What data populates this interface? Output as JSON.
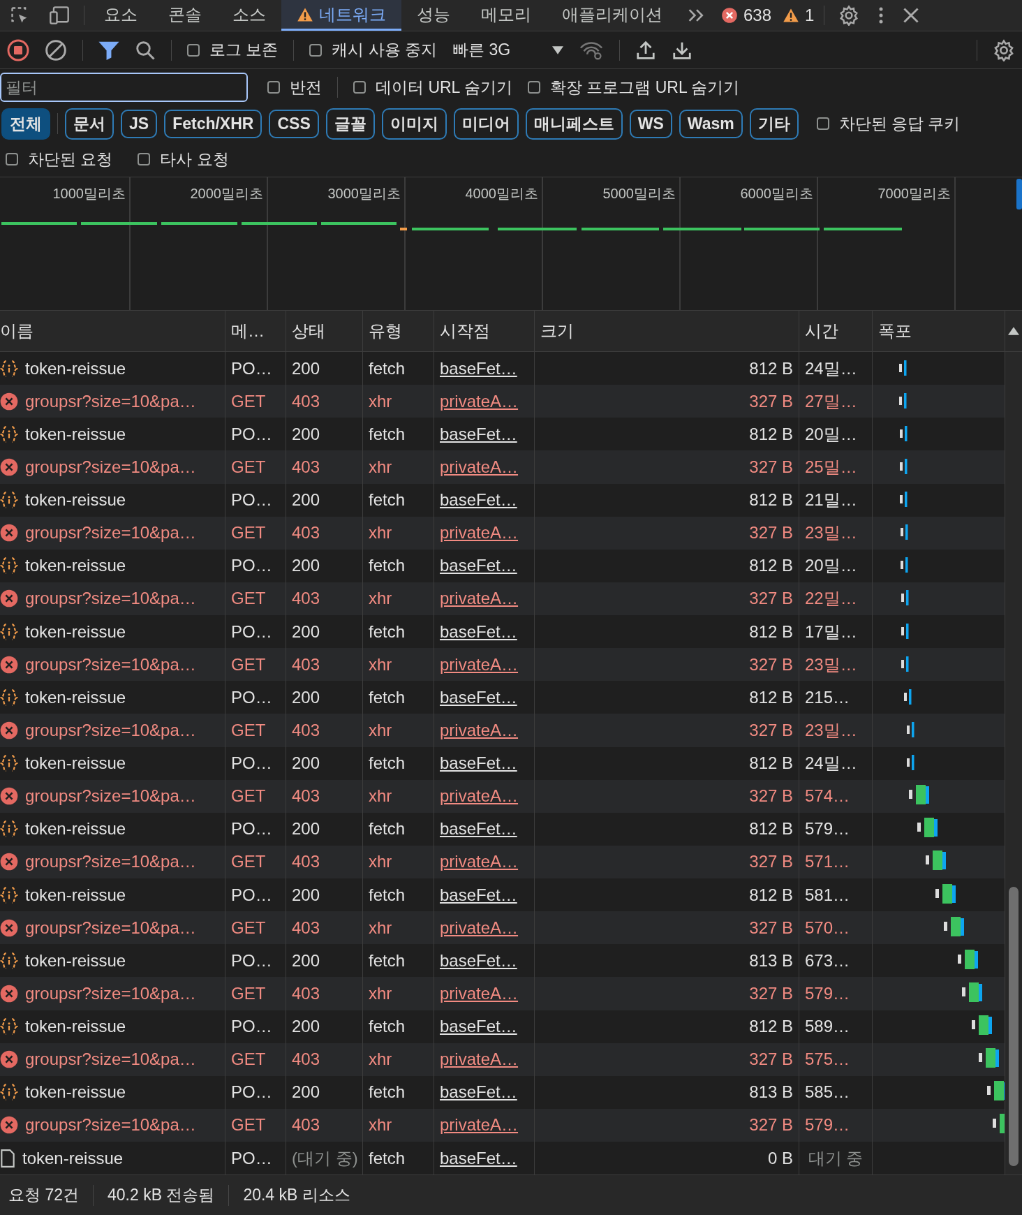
{
  "tabs": [
    {
      "label": "요소",
      "selected": false,
      "warning": false
    },
    {
      "label": "콘솔",
      "selected": false,
      "warning": false
    },
    {
      "label": "소스",
      "selected": false,
      "warning": false
    },
    {
      "label": "네트워크",
      "selected": true,
      "warning": true
    },
    {
      "label": "성능",
      "selected": false,
      "warning": false
    },
    {
      "label": "메모리",
      "selected": false,
      "warning": false
    },
    {
      "label": "애플리케이션",
      "selected": false,
      "warning": false
    }
  ],
  "counts": {
    "errors": "638",
    "warnings": "1"
  },
  "toolbar": {
    "recording": true,
    "filter_active": true,
    "options": [
      {
        "label": "로그 보존",
        "checked": false
      },
      {
        "label": "캐시 사용 중지",
        "checked": false
      }
    ],
    "throttling": "빠른 3G"
  },
  "filter": {
    "placeholder": "필터",
    "options": [
      {
        "label": "반전",
        "checked": false
      },
      {
        "label": "데이터 URL 숨기기",
        "checked": false
      },
      {
        "label": "확장 프로그램 URL 숨기기",
        "checked": false
      }
    ]
  },
  "type_filters": [
    {
      "label": "전체",
      "selected": true
    },
    {
      "label": "문서",
      "selected": false
    },
    {
      "label": "JS",
      "selected": false
    },
    {
      "label": "Fetch/XHR",
      "selected": false
    },
    {
      "label": "CSS",
      "selected": false
    },
    {
      "label": "글꼴",
      "selected": false
    },
    {
      "label": "이미지",
      "selected": false
    },
    {
      "label": "미디어",
      "selected": false
    },
    {
      "label": "매니페스트",
      "selected": false
    },
    {
      "label": "WS",
      "selected": false
    },
    {
      "label": "Wasm",
      "selected": false
    },
    {
      "label": "기타",
      "selected": false
    }
  ],
  "blocked_cookies": {
    "label": "차단된 응답 쿠키",
    "checked": false
  },
  "extra_options": [
    {
      "label": "차단된 요청",
      "checked": false
    },
    {
      "label": "타사 요청",
      "checked": false
    }
  ],
  "overview": {
    "ticks": [
      "1000밀리초",
      "2000밀리초",
      "3000밀리초",
      "4000밀리초",
      "5000밀리초",
      "6000밀리초",
      "7000밀리초"
    ]
  },
  "table": {
    "columns": [
      "이름",
      "메…",
      "상태",
      "유형",
      "시작점",
      "크기",
      "시간",
      "폭포"
    ],
    "rows": [
      {
        "kind": "fetch",
        "name": "token-reissue",
        "method": "PO…",
        "status": "200",
        "type": "fetch",
        "initiator": "baseFet…",
        "size": "812 B",
        "time": "24밀…"
      },
      {
        "kind": "error",
        "name": "groupsr?size=10&pa…",
        "method": "GET",
        "status": "403",
        "type": "xhr",
        "initiator": "privateA…",
        "size": "327 B",
        "time": "27밀…"
      },
      {
        "kind": "fetch",
        "name": "token-reissue",
        "method": "PO…",
        "status": "200",
        "type": "fetch",
        "initiator": "baseFet…",
        "size": "812 B",
        "time": "20밀…"
      },
      {
        "kind": "error",
        "name": "groupsr?size=10&pa…",
        "method": "GET",
        "status": "403",
        "type": "xhr",
        "initiator": "privateA…",
        "size": "327 B",
        "time": "25밀…"
      },
      {
        "kind": "fetch",
        "name": "token-reissue",
        "method": "PO…",
        "status": "200",
        "type": "fetch",
        "initiator": "baseFet…",
        "size": "812 B",
        "time": "21밀…"
      },
      {
        "kind": "error",
        "name": "groupsr?size=10&pa…",
        "method": "GET",
        "status": "403",
        "type": "xhr",
        "initiator": "privateA…",
        "size": "327 B",
        "time": "23밀…"
      },
      {
        "kind": "fetch",
        "name": "token-reissue",
        "method": "PO…",
        "status": "200",
        "type": "fetch",
        "initiator": "baseFet…",
        "size": "812 B",
        "time": "20밀…"
      },
      {
        "kind": "error",
        "name": "groupsr?size=10&pa…",
        "method": "GET",
        "status": "403",
        "type": "xhr",
        "initiator": "privateA…",
        "size": "327 B",
        "time": "22밀…"
      },
      {
        "kind": "fetch",
        "name": "token-reissue",
        "method": "PO…",
        "status": "200",
        "type": "fetch",
        "initiator": "baseFet…",
        "size": "812 B",
        "time": "17밀…"
      },
      {
        "kind": "error",
        "name": "groupsr?size=10&pa…",
        "method": "GET",
        "status": "403",
        "type": "xhr",
        "initiator": "privateA…",
        "size": "327 B",
        "time": "23밀…"
      },
      {
        "kind": "fetch",
        "name": "token-reissue",
        "method": "PO…",
        "status": "200",
        "type": "fetch",
        "initiator": "baseFet…",
        "size": "812 B",
        "time": "215…"
      },
      {
        "kind": "error",
        "name": "groupsr?size=10&pa…",
        "method": "GET",
        "status": "403",
        "type": "xhr",
        "initiator": "privateA…",
        "size": "327 B",
        "time": "23밀…"
      },
      {
        "kind": "fetch",
        "name": "token-reissue",
        "method": "PO…",
        "status": "200",
        "type": "fetch",
        "initiator": "baseFet…",
        "size": "812 B",
        "time": "24밀…"
      },
      {
        "kind": "error",
        "name": "groupsr?size=10&pa…",
        "method": "GET",
        "status": "403",
        "type": "xhr",
        "initiator": "privateA…",
        "size": "327 B",
        "time": "574…"
      },
      {
        "kind": "fetch",
        "name": "token-reissue",
        "method": "PO…",
        "status": "200",
        "type": "fetch",
        "initiator": "baseFet…",
        "size": "812 B",
        "time": "579…"
      },
      {
        "kind": "error",
        "name": "groupsr?size=10&pa…",
        "method": "GET",
        "status": "403",
        "type": "xhr",
        "initiator": "privateA…",
        "size": "327 B",
        "time": "571…"
      },
      {
        "kind": "fetch",
        "name": "token-reissue",
        "method": "PO…",
        "status": "200",
        "type": "fetch",
        "initiator": "baseFet…",
        "size": "812 B",
        "time": "581…"
      },
      {
        "kind": "error",
        "name": "groupsr?size=10&pa…",
        "method": "GET",
        "status": "403",
        "type": "xhr",
        "initiator": "privateA…",
        "size": "327 B",
        "time": "570…"
      },
      {
        "kind": "fetch",
        "name": "token-reissue",
        "method": "PO…",
        "status": "200",
        "type": "fetch",
        "initiator": "baseFet…",
        "size": "813 B",
        "time": "673…"
      },
      {
        "kind": "error",
        "name": "groupsr?size=10&pa…",
        "method": "GET",
        "status": "403",
        "type": "xhr",
        "initiator": "privateA…",
        "size": "327 B",
        "time": "579…"
      },
      {
        "kind": "fetch",
        "name": "token-reissue",
        "method": "PO…",
        "status": "200",
        "type": "fetch",
        "initiator": "baseFet…",
        "size": "812 B",
        "time": "589…"
      },
      {
        "kind": "error",
        "name": "groupsr?size=10&pa…",
        "method": "GET",
        "status": "403",
        "type": "xhr",
        "initiator": "privateA…",
        "size": "327 B",
        "time": "575…"
      },
      {
        "kind": "fetch",
        "name": "token-reissue",
        "method": "PO…",
        "status": "200",
        "type": "fetch",
        "initiator": "baseFet…",
        "size": "813 B",
        "time": "585…"
      },
      {
        "kind": "error",
        "name": "groupsr?size=10&pa…",
        "method": "GET",
        "status": "403",
        "type": "xhr",
        "initiator": "privateA…",
        "size": "327 B",
        "time": "579…"
      },
      {
        "kind": "pending",
        "name": "token-reissue",
        "method": "PO…",
        "status": "(대기 중)",
        "type": "fetch",
        "initiator": "baseFet…",
        "size": "0 B",
        "time": "대기 중"
      }
    ]
  },
  "status_bar": [
    "요청 72건",
    "40.2 kB 전송됨",
    "20.4 kB 리소스"
  ]
}
